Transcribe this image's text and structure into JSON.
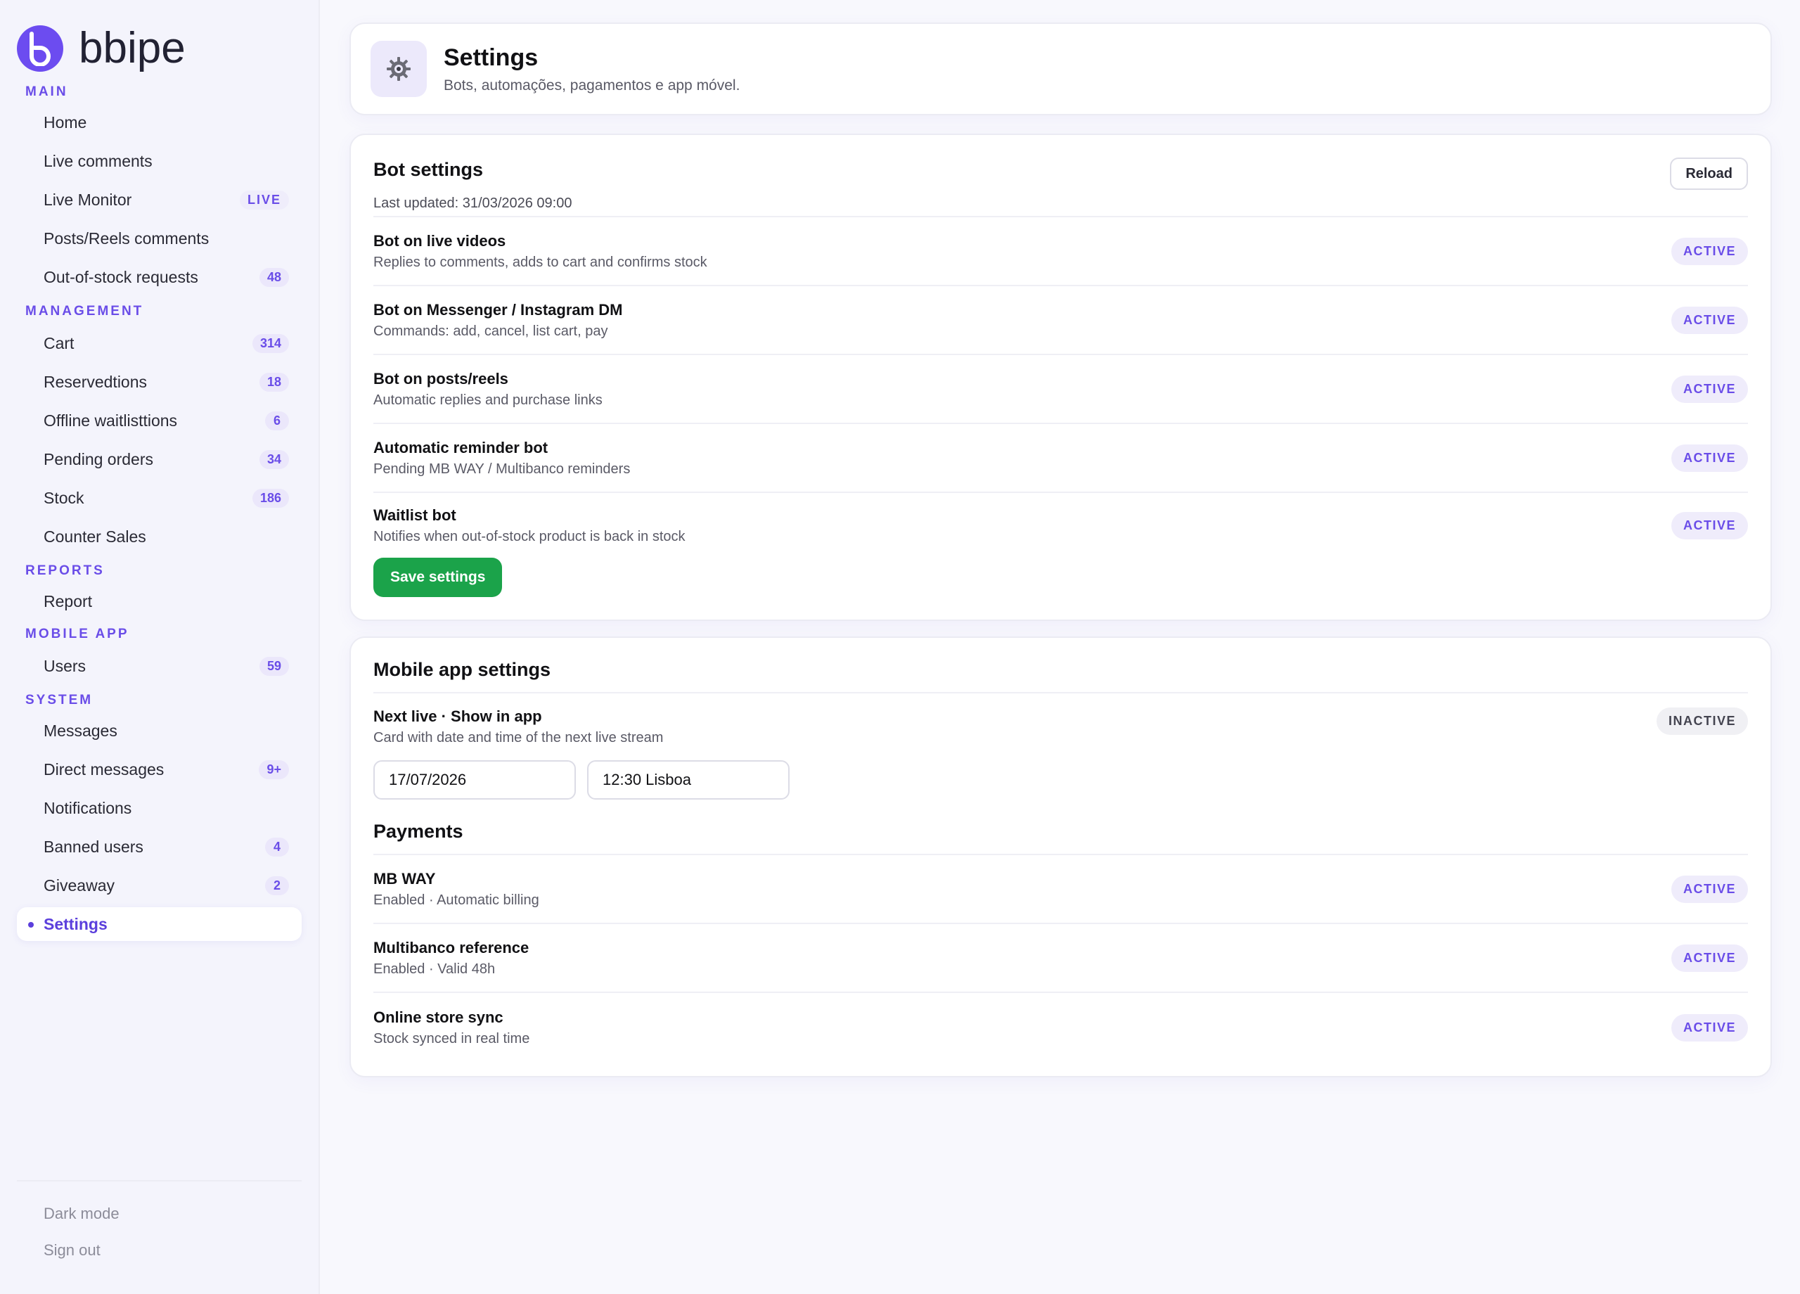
{
  "brand": {
    "name": "bbipe"
  },
  "sidebar": {
    "sections": [
      {
        "title": "MAIN",
        "items": [
          {
            "label": "Home"
          },
          {
            "label": "Live comments"
          },
          {
            "label": "Live Monitor",
            "badge": "LIVE"
          },
          {
            "label": "Posts/Reels comments"
          },
          {
            "label": "Out-of-stock requests",
            "badge": "48"
          }
        ]
      },
      {
        "title": "MANAGEMENT",
        "items": [
          {
            "label": "Cart",
            "badge": "314"
          },
          {
            "label": "Reservedtions",
            "badge": "18"
          },
          {
            "label": "Offline waitlisttions",
            "badge": "6"
          },
          {
            "label": "Pending orders",
            "badge": "34"
          },
          {
            "label": "Stock",
            "badge": "186"
          },
          {
            "label": "Counter Sales"
          }
        ]
      },
      {
        "title": "REPORTS",
        "items": [
          {
            "label": "Report"
          }
        ]
      },
      {
        "title": "MOBILE APP",
        "items": [
          {
            "label": "Users",
            "badge": "59"
          }
        ]
      },
      {
        "title": "SYSTEM",
        "items": [
          {
            "label": "Messages"
          },
          {
            "label": "Direct messages",
            "badge": "9+"
          },
          {
            "label": "Notifications"
          },
          {
            "label": "Banned users",
            "badge": "4"
          },
          {
            "label": "Giveaway",
            "badge": "2"
          },
          {
            "label": "Settings",
            "active": true
          }
        ]
      }
    ],
    "footer": {
      "dark_mode": "Dark mode",
      "sign_out": "Sign out"
    }
  },
  "header": {
    "icon": "gear-icon",
    "title": "Settings",
    "subtitle": "Bots, automações, pagamentos e app móvel."
  },
  "bot_settings": {
    "title": "Bot settings",
    "reload_label": "Reload",
    "last_updated": "Last updated: 31/03/2026 09:00",
    "rows": [
      {
        "title": "Bot on live videos",
        "desc": "Replies to comments, adds to cart and confirms stock",
        "status": "ACTIVE"
      },
      {
        "title": "Bot on Messenger / Instagram DM",
        "desc": "Commands: add, cancel, list cart, pay",
        "status": "ACTIVE"
      },
      {
        "title": "Bot on posts/reels",
        "desc": "Automatic replies and purchase links",
        "status": "ACTIVE"
      },
      {
        "title": "Automatic reminder bot",
        "desc": "Pending MB WAY / Multibanco reminders",
        "status": "ACTIVE"
      },
      {
        "title": "Waitlist bot",
        "desc": "Notifies when out-of-stock product is back in stock",
        "status": "ACTIVE"
      }
    ],
    "save_label": "Save settings"
  },
  "mobile_app": {
    "title": "Mobile app settings",
    "next_live": {
      "title": "Next live · Show in app",
      "desc": "Card with date and time of the next live stream",
      "status": "INACTIVE",
      "date_value": "17/07/2026",
      "time_value": "12:30 Lisboa"
    },
    "payments_title": "Payments",
    "payments": [
      {
        "title": "MB WAY",
        "desc": "Enabled · Automatic billing",
        "status": "ACTIVE"
      },
      {
        "title": "Multibanco reference",
        "desc": "Enabled · Valid 48h",
        "status": "ACTIVE"
      },
      {
        "title": "Online store sync",
        "desc": "Stock synced in real time",
        "status": "ACTIVE"
      }
    ]
  },
  "colors": {
    "accent": "#6a4de8",
    "save": "#1ba34a",
    "background": "#f8f8fd"
  }
}
